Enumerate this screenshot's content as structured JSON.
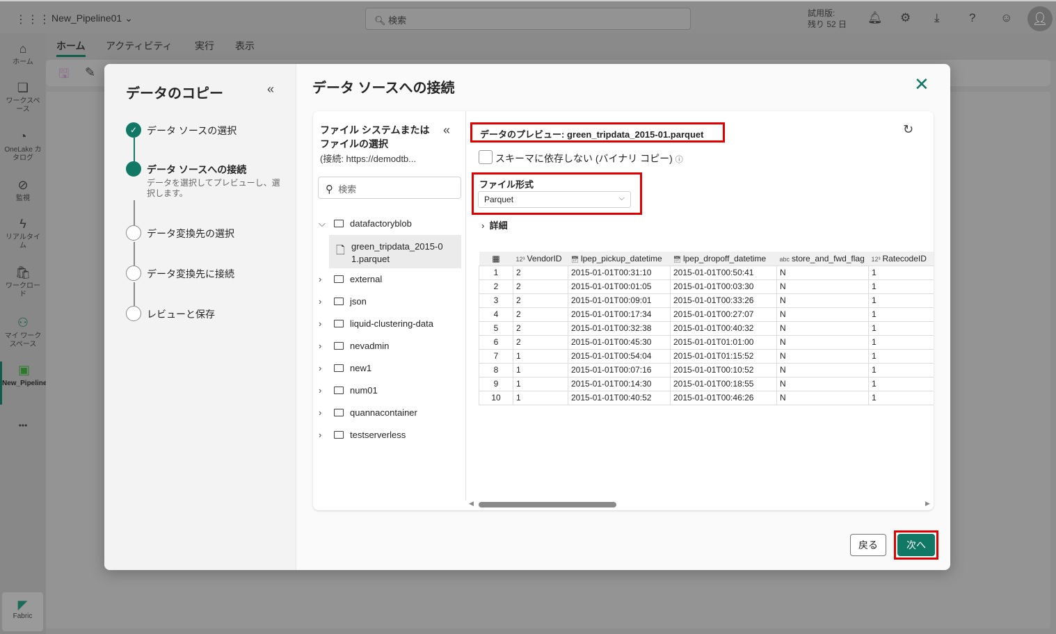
{
  "app": {
    "title": "New_Pipeline01",
    "search_placeholder": "検索",
    "trial_line1": "試用版:",
    "trial_line2": "残り 52 日"
  },
  "leftnav": {
    "items": [
      {
        "label": "ホーム",
        "icon": "home-icon"
      },
      {
        "label": "ワークスペース",
        "icon": "workspaces-icon"
      },
      {
        "label": "OneLake カタログ",
        "icon": "onelake-icon"
      },
      {
        "label": "監視",
        "icon": "monitor-icon"
      },
      {
        "label": "リアルタイム",
        "icon": "realtime-icon"
      },
      {
        "label": "ワークロード",
        "icon": "workload-icon"
      },
      {
        "label": "マイ ワークスペース",
        "icon": "person-icon"
      },
      {
        "label": "New_Pipeline01",
        "icon": "pipeline-icon"
      }
    ],
    "more": "•••",
    "fabric": "Fabric"
  },
  "ribbon": {
    "tabs": [
      "ホーム",
      "アクティビティ",
      "実行",
      "表示"
    ]
  },
  "wizard": {
    "title": "データのコピー",
    "steps": [
      {
        "label": "データ ソースの選択",
        "state": "done"
      },
      {
        "label": "データ ソースへの接続",
        "state": "current",
        "desc": "データを選択してプレビューし、選択します。"
      },
      {
        "label": "データ変換先の選択",
        "state": "pending"
      },
      {
        "label": "データ変換先に接続",
        "state": "pending"
      },
      {
        "label": "レビューと保存",
        "state": "pending"
      }
    ],
    "main_title": "データ ソースへの接続",
    "files": {
      "title": "ファイル システムまたはファイルの選択",
      "connection": "(接続: https://demodtb...",
      "search_placeholder": "検索",
      "root": "datafactoryblob",
      "selected_file": "green_tripdata_2015-01.parquet",
      "folders": [
        "external",
        "json",
        "liquid-clustering-data",
        "nevadmin",
        "new1",
        "num01",
        "quannacontainer",
        "testserverless"
      ]
    },
    "preview": {
      "title": "データのプレビュー: green_tripdata_2015-01.parquet",
      "binary_label": "スキーマに依存しない (バイナリ コピー)",
      "binary_checked": false,
      "format_label": "ファイル形式",
      "format_value": "Parquet",
      "details_label": "詳細",
      "columns": [
        {
          "type": "12³",
          "name": "VendorID"
        },
        {
          "type": "date",
          "name": "lpep_pickup_datetime"
        },
        {
          "type": "date",
          "name": "lpep_dropoff_datetime"
        },
        {
          "type": "abc",
          "name": "store_and_fwd_flag"
        },
        {
          "type": "12³",
          "name": "RatecodeID"
        }
      ],
      "rows": [
        [
          "1",
          "2",
          "2015-01-01T00:31:10",
          "2015-01-01T00:50:41",
          "N",
          "1"
        ],
        [
          "2",
          "2",
          "2015-01-01T00:01:05",
          "2015-01-01T00:03:30",
          "N",
          "1"
        ],
        [
          "3",
          "2",
          "2015-01-01T00:09:01",
          "2015-01-01T00:33:26",
          "N",
          "1"
        ],
        [
          "4",
          "2",
          "2015-01-01T00:17:34",
          "2015-01-01T00:27:07",
          "N",
          "1"
        ],
        [
          "5",
          "2",
          "2015-01-01T00:32:38",
          "2015-01-01T00:40:32",
          "N",
          "1"
        ],
        [
          "6",
          "2",
          "2015-01-01T00:45:30",
          "2015-01-01T01:01:00",
          "N",
          "1"
        ],
        [
          "7",
          "1",
          "2015-01-01T00:54:04",
          "2015-01-01T01:15:52",
          "N",
          "1"
        ],
        [
          "8",
          "1",
          "2015-01-01T00:07:16",
          "2015-01-01T00:10:52",
          "N",
          "1"
        ],
        [
          "9",
          "1",
          "2015-01-01T00:14:30",
          "2015-01-01T00:18:55",
          "N",
          "1"
        ],
        [
          "10",
          "1",
          "2015-01-01T00:40:52",
          "2015-01-01T00:46:26",
          "N",
          "1"
        ]
      ]
    },
    "back_label": "戻る",
    "next_label": "次へ"
  },
  "colors": {
    "accent": "#117865",
    "highlight": "#e00000"
  }
}
